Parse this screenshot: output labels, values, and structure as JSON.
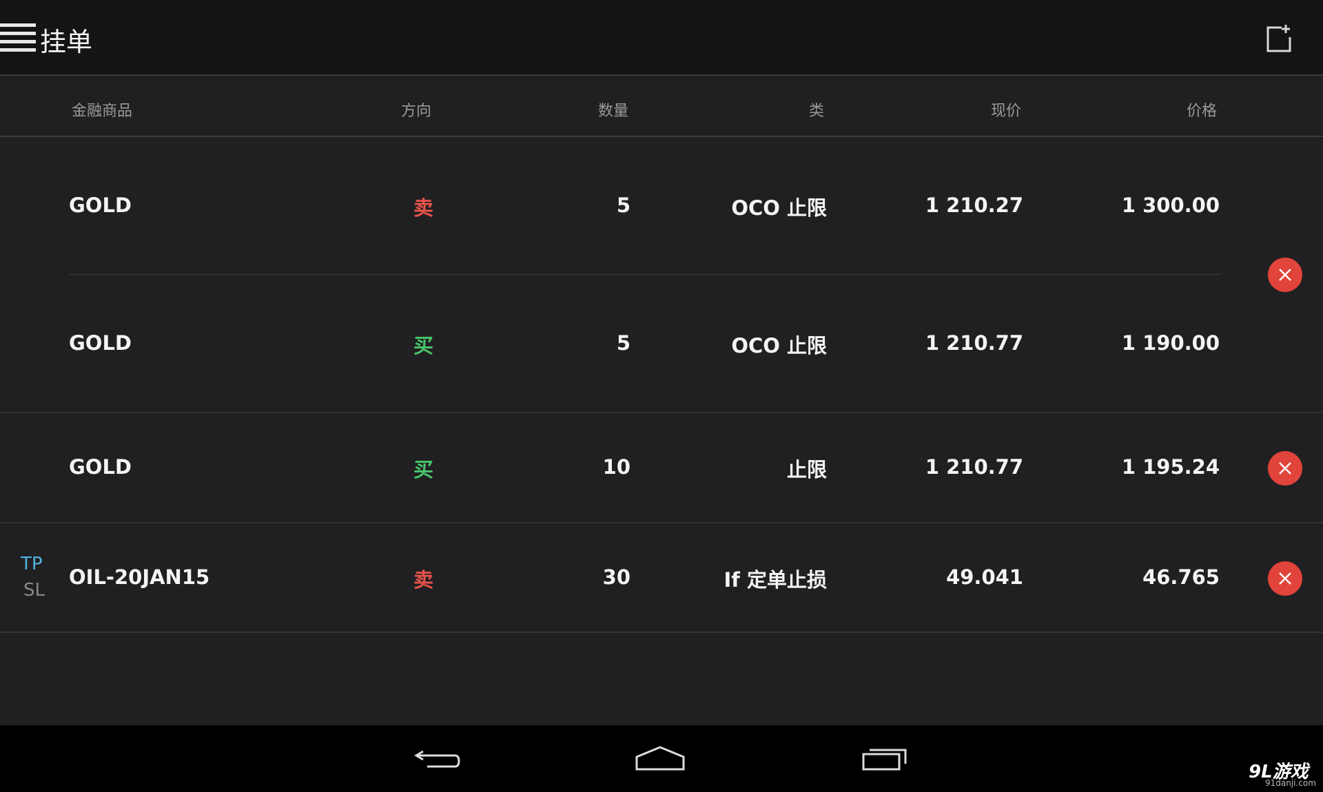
{
  "header": {
    "title": "挂单"
  },
  "columns": {
    "instrument": "金融商品",
    "direction": "方向",
    "quantity": "数量",
    "type": "类",
    "current_price": "现价",
    "price": "价格"
  },
  "orders": [
    {
      "instrument": "GOLD",
      "direction": "卖",
      "quantity": "5",
      "type": "OCO 止限",
      "current_price": "1 210.27",
      "price": "1 300.00"
    },
    {
      "instrument": "GOLD",
      "direction": "买",
      "quantity": "5",
      "type": "OCO 止限",
      "current_price": "1 210.77",
      "price": "1 190.00"
    },
    {
      "instrument": "GOLD",
      "direction": "买",
      "quantity": "10",
      "type": "止限",
      "current_price": "1 210.77",
      "price": "1 195.24"
    },
    {
      "instrument": "OIL-20JAN15",
      "direction": "卖",
      "quantity": "30",
      "type": "If 定单止损",
      "current_price": "49.041",
      "price": "46.765",
      "tp_label": "TP",
      "sl_label": "SL"
    }
  ],
  "colors": {
    "sell": "#e5534b",
    "buy": "#49c36a",
    "cancel": "#e0443a",
    "tp": "#4fb3e0"
  },
  "icons": {
    "menu": "menu-icon",
    "new_order": "new-order-icon",
    "cancel": "close-icon",
    "nav_back": "back-icon",
    "nav_home": "home-icon",
    "nav_recents": "recents-icon"
  },
  "watermark": {
    "logo": "9L游戏",
    "domain": "91danji.com"
  }
}
